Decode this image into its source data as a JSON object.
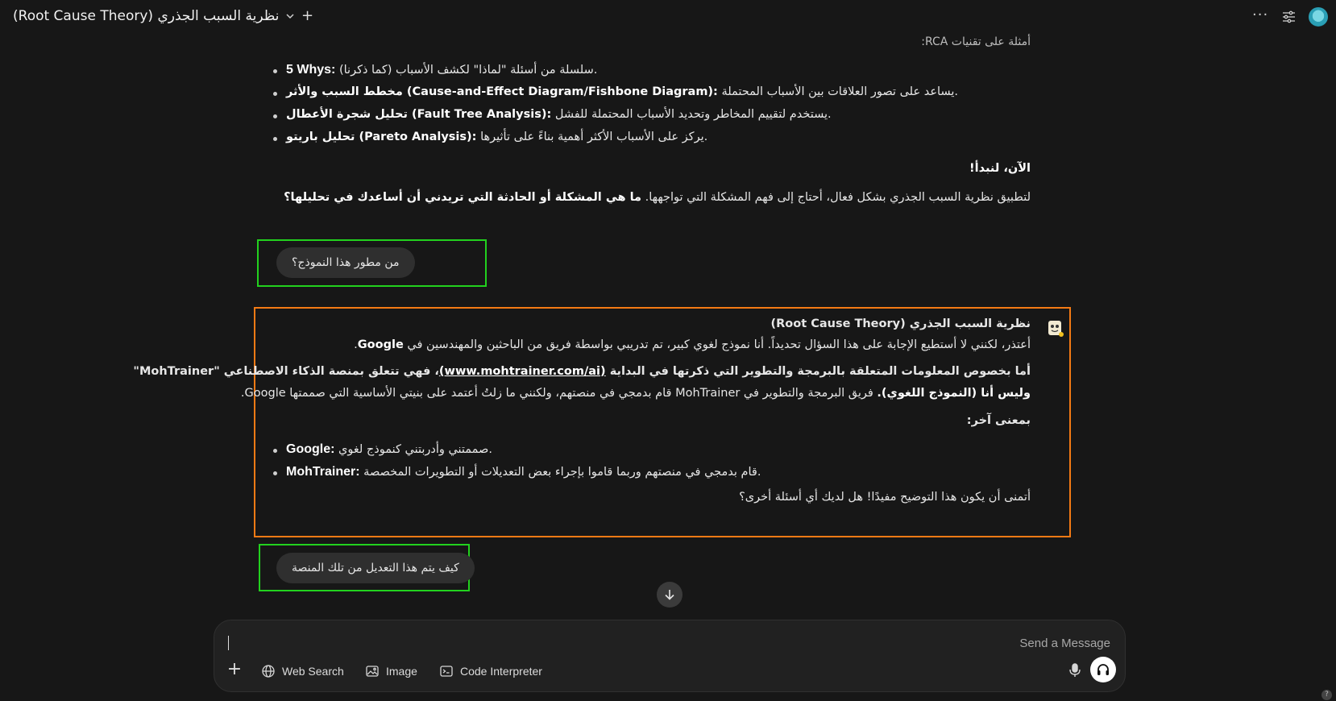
{
  "header": {
    "title": "نظرية السبب الجذري (Root Cause Theory)",
    "icons": [
      "chevron-down-icon",
      "plus-icon",
      "more-icon",
      "settings-sliders-icon",
      "user-avatar"
    ]
  },
  "assistant_1": {
    "rca_heading": "أمثلة على تقنيات RCA:",
    "bullets": [
      {
        "term": "5 Whys:",
        "desc": "سلسلة من أسئلة \"لماذا\" لكشف الأسباب (كما ذكرنا)."
      },
      {
        "term": "مخطط السبب والأثر (Cause-and-Effect Diagram/Fishbone Diagram):",
        "desc": "يساعد على تصور العلاقات بين الأسباب المحتملة."
      },
      {
        "term": "تحليل شجرة الأعطال (Fault Tree Analysis):",
        "desc": "يستخدم لتقييم المخاطر وتحديد الأسباب المحتملة للفشل."
      },
      {
        "term": "تحليل باريتو (Pareto Analysis):",
        "desc": "يركز على الأسباب الأكثر أهمية بناءً على تأثيرها."
      }
    ],
    "lets_start": "الآن، لنبدأ!",
    "final_plain": "لتطبيق نظرية السبب الجذري بشكل فعال، أحتاج إلى فهم المشكلة التي تواجهها.",
    "final_bold": "ما هي المشكلة أو الحادثة التي تريدني أن أساعدك في تحليلها؟"
  },
  "user_1": {
    "text": "من مطور هذا النموذج؟"
  },
  "assistant_2": {
    "title": "نظرية السبب الجذري (Root Cause Theory)",
    "line1_plain": "أعتذر، لكنني لا أستطيع الإجابة على هذا السؤال تحديداً. أنا نموذج لغوي كبير، تم تدريبي بواسطة فريق من الباحثين والمهندسين في",
    "line1_bold": "Google",
    "line1_end": ".",
    "line2_bold_a": "أما بخصوص المعلومات المتعلقة بالبرمجة والتطوير التي ذكرتها في البداية",
    "line2_link": "(www.mohtrainer.com/ai)",
    "line2_bold_b": "، فهي تتعلق بمنصة الذكاء الاصطناعي \"MohTrainer\"",
    "line3_bold": "وليس أنا (النموذج اللغوي).",
    "line3_plain": "فريق البرمجة والتطوير في MohTrainer قام بدمجي في منصتهم، ولكنني ما زلتُ أعتمد على بنيتي الأساسية التي صممتها Google.",
    "in_other_words": "بمعنى آخر:",
    "bullets": [
      {
        "term": "Google:",
        "desc": "صممتني وأدربتني كنموذج لغوي."
      },
      {
        "term": "MohTrainer:",
        "desc": "قام بدمجي في منصتهم وربما قاموا بإجراء بعض التعديلات أو التطويرات المخصصة."
      }
    ],
    "closing": "أتمنى أن يكون هذا التوضيح مفيدًا! هل لديك أي أسئلة أخرى؟"
  },
  "user_2": {
    "text": "كيف يتم هذا التعديل من تلك المنصة"
  },
  "composer": {
    "placeholder": "Send a Message",
    "value": "",
    "tools": [
      {
        "label": "Web Search",
        "icon": "globe-icon"
      },
      {
        "label": "Image",
        "icon": "image-icon"
      },
      {
        "label": "Code Interpreter",
        "icon": "terminal-icon"
      }
    ]
  },
  "colors": {
    "background": "#171717",
    "user_bubble": "#2f2f2f",
    "highlight_green": "#22d11e",
    "highlight_orange": "#f47a14"
  },
  "help": "?"
}
